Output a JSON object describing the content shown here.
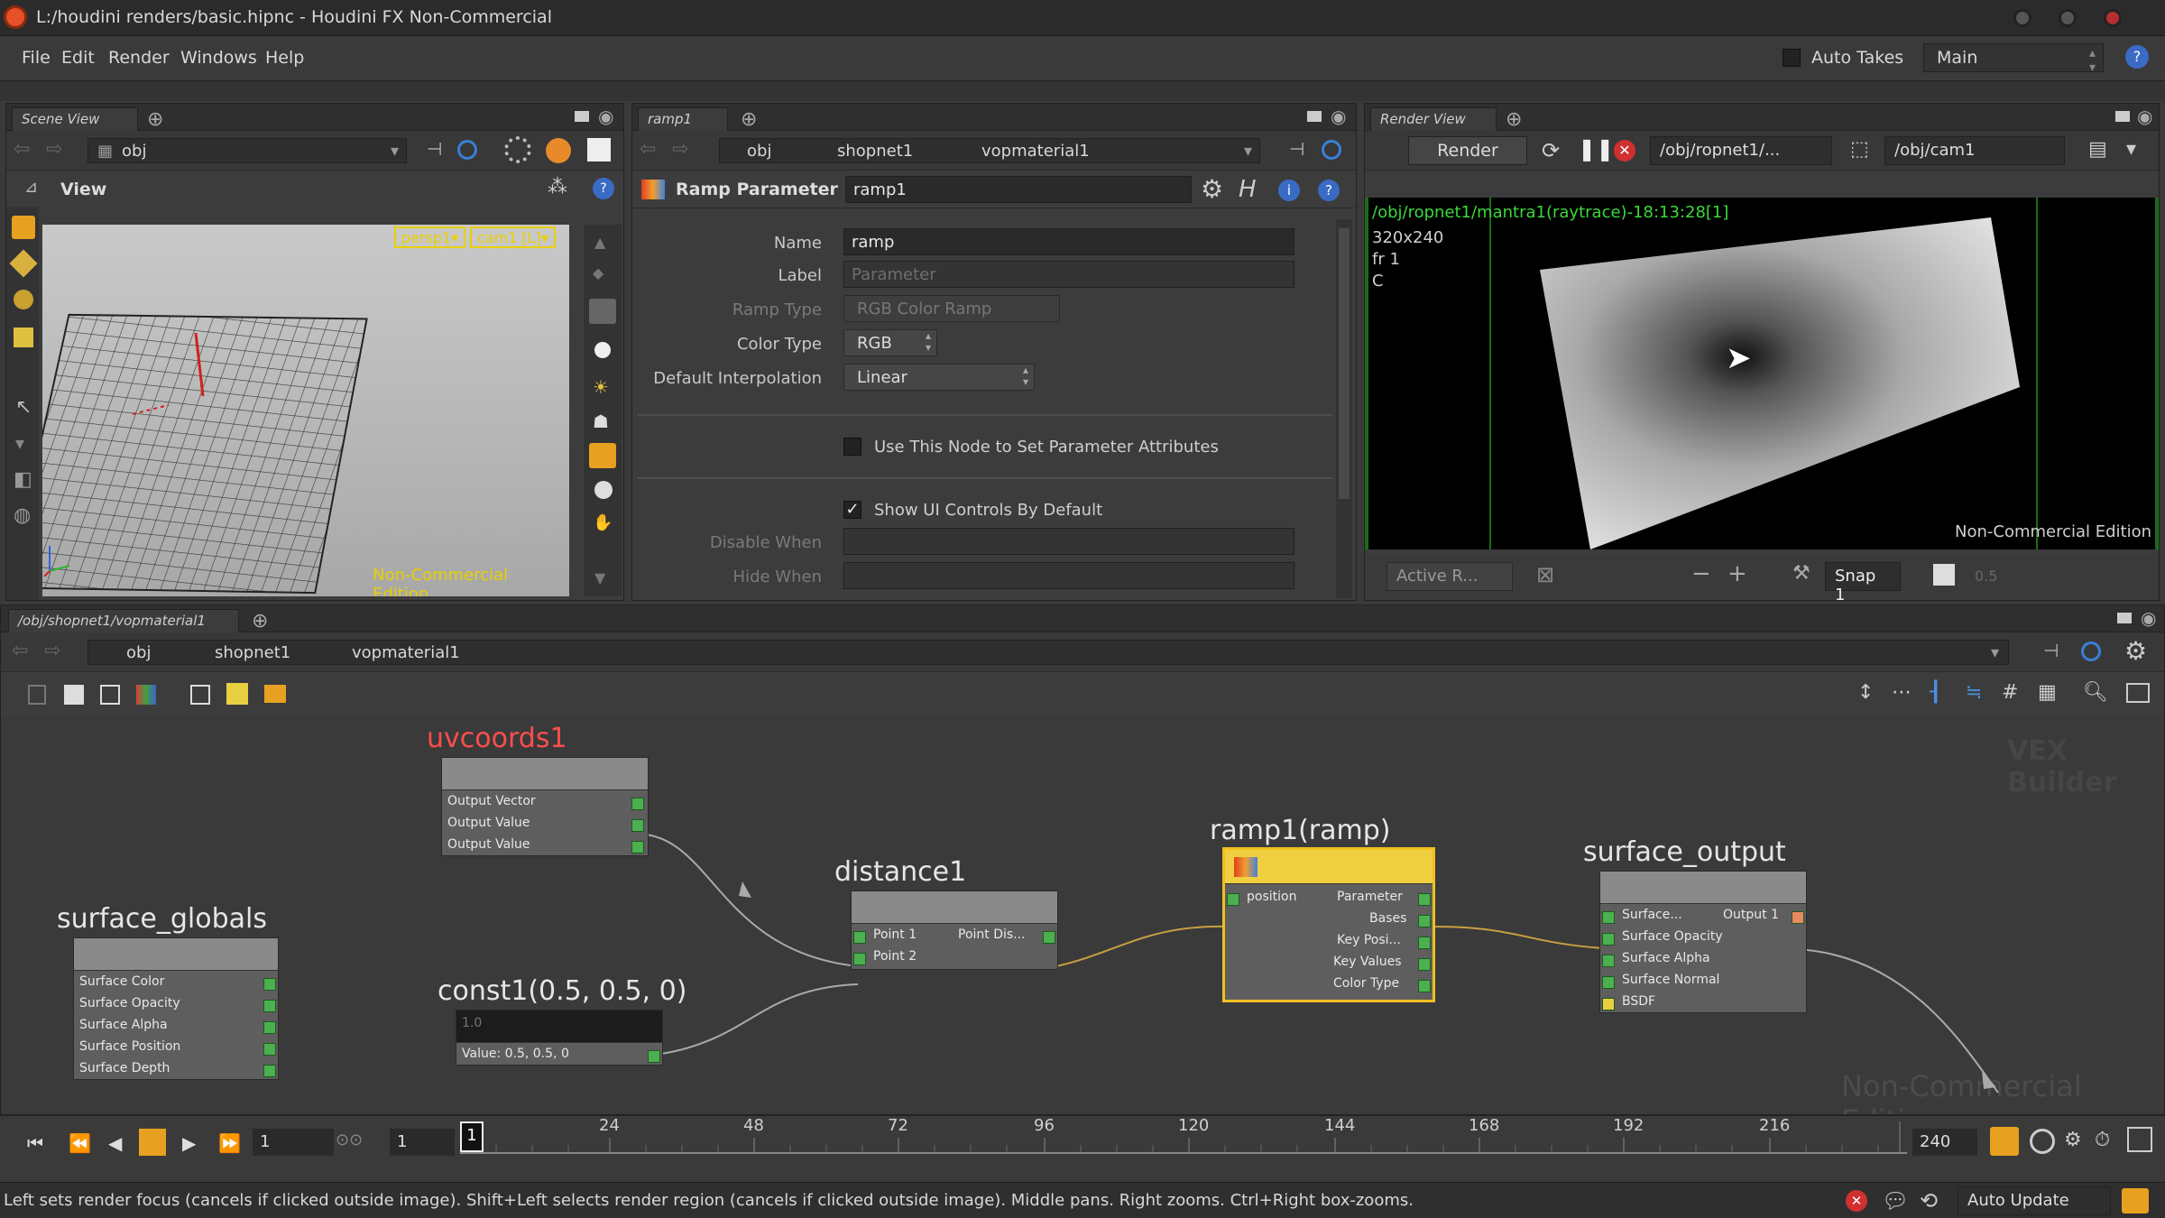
{
  "window": {
    "title": "L:/houdini renders/basic.hipnc - Houdini FX Non-Commercial"
  },
  "menu": {
    "file": "File",
    "edit": "Edit",
    "render": "Render",
    "windows": "Windows",
    "help": "Help"
  },
  "top_right": {
    "auto_takes": "Auto Takes",
    "desktop": "Main"
  },
  "scene_view": {
    "tab": "Scene View",
    "path": "obj",
    "view_label": "View",
    "persp": "persp1▾",
    "cam": "cam1 [L]▾",
    "watermark": "Non-Commercial Edition"
  },
  "params": {
    "tab": "ramp1",
    "crumbs": [
      "obj",
      "shopnet1",
      "vopmaterial1"
    ],
    "header_type": "Ramp Parameter",
    "header_name": "ramp1",
    "name_label": "Name",
    "name_value": "ramp",
    "label_label": "Label",
    "label_value": "Parameter",
    "ramp_type_label": "Ramp Type",
    "ramp_type_value": "RGB Color Ramp",
    "color_type_label": "Color Type",
    "color_type_value": "RGB",
    "interp_label": "Default Interpolation",
    "interp_value": "Linear",
    "use_node_label": "Use This Node to Set Parameter Attributes",
    "show_ui_label": "Show UI Controls By Default",
    "disable_when_label": "Disable When",
    "hide_when_label": "Hide When"
  },
  "render_view": {
    "tab": "Render View",
    "render_btn": "Render",
    "rop": "/obj/ropnet1/...",
    "cam": "/obj/cam1",
    "info_path": "/obj/ropnet1/mantra1(raytrace)-18:13:28[1]",
    "info_res": "320x240",
    "info_frame": "fr 1",
    "info_c": "C",
    "watermark": "Non-Commercial Edition",
    "active": "Active R...",
    "snap": "Snap 1",
    "snap_val": "0.5"
  },
  "network": {
    "tab": "/obj/shopnet1/vopmaterial1",
    "crumbs": [
      "obj",
      "shopnet1",
      "vopmaterial1"
    ],
    "context_label": "VEX Builder",
    "watermark": "Non-Commercial Edition",
    "nodes": {
      "uvcoords": {
        "title": "uvcoords1",
        "ports": [
          "Output Vector",
          "Output Value",
          "Output Value"
        ]
      },
      "globals": {
        "title": "surface_globals",
        "ports": [
          "Surface Color",
          "Surface Opacity",
          "Surface Alpha",
          "Surface Position",
          "Surface Depth"
        ]
      },
      "const": {
        "title": "const1(0.5, 0.5, 0)",
        "value": "Value: 0.5, 0.5, 0",
        "chip": "1.0"
      },
      "distance": {
        "title": "distance1",
        "in1": "Point 1",
        "in2": "Point 2",
        "out": "Point Dis..."
      },
      "ramp": {
        "title": "ramp1(ramp)",
        "in": "position",
        "outs": [
          "Parameter",
          "Bases",
          "Key Posi...",
          "Key Values",
          "Color Type"
        ]
      },
      "output": {
        "title": "surface_output",
        "ins": [
          "Surface...",
          "Surface Opacity",
          "Surface Alpha",
          "Surface Normal",
          "BSDF"
        ],
        "out": "Output 1"
      }
    }
  },
  "timeline": {
    "start": "1",
    "start2": "1",
    "current": "1",
    "end": "240",
    "ticks": [
      "24",
      "48",
      "72",
      "96",
      "120",
      "144",
      "168",
      "192",
      "216"
    ]
  },
  "status": {
    "message": "Left sets render focus (cancels if clicked outside image). Shift+Left selects render region (cancels if clicked outside image). Middle pans. Right zooms. Ctrl+Right box-zooms.",
    "auto_update": "Auto Update"
  },
  "colors": {
    "node_selected": "#f0c020",
    "node_title_red": "#ff4d4d",
    "port_green": "#4caf50",
    "watermark_yellow": "#e8d000"
  }
}
